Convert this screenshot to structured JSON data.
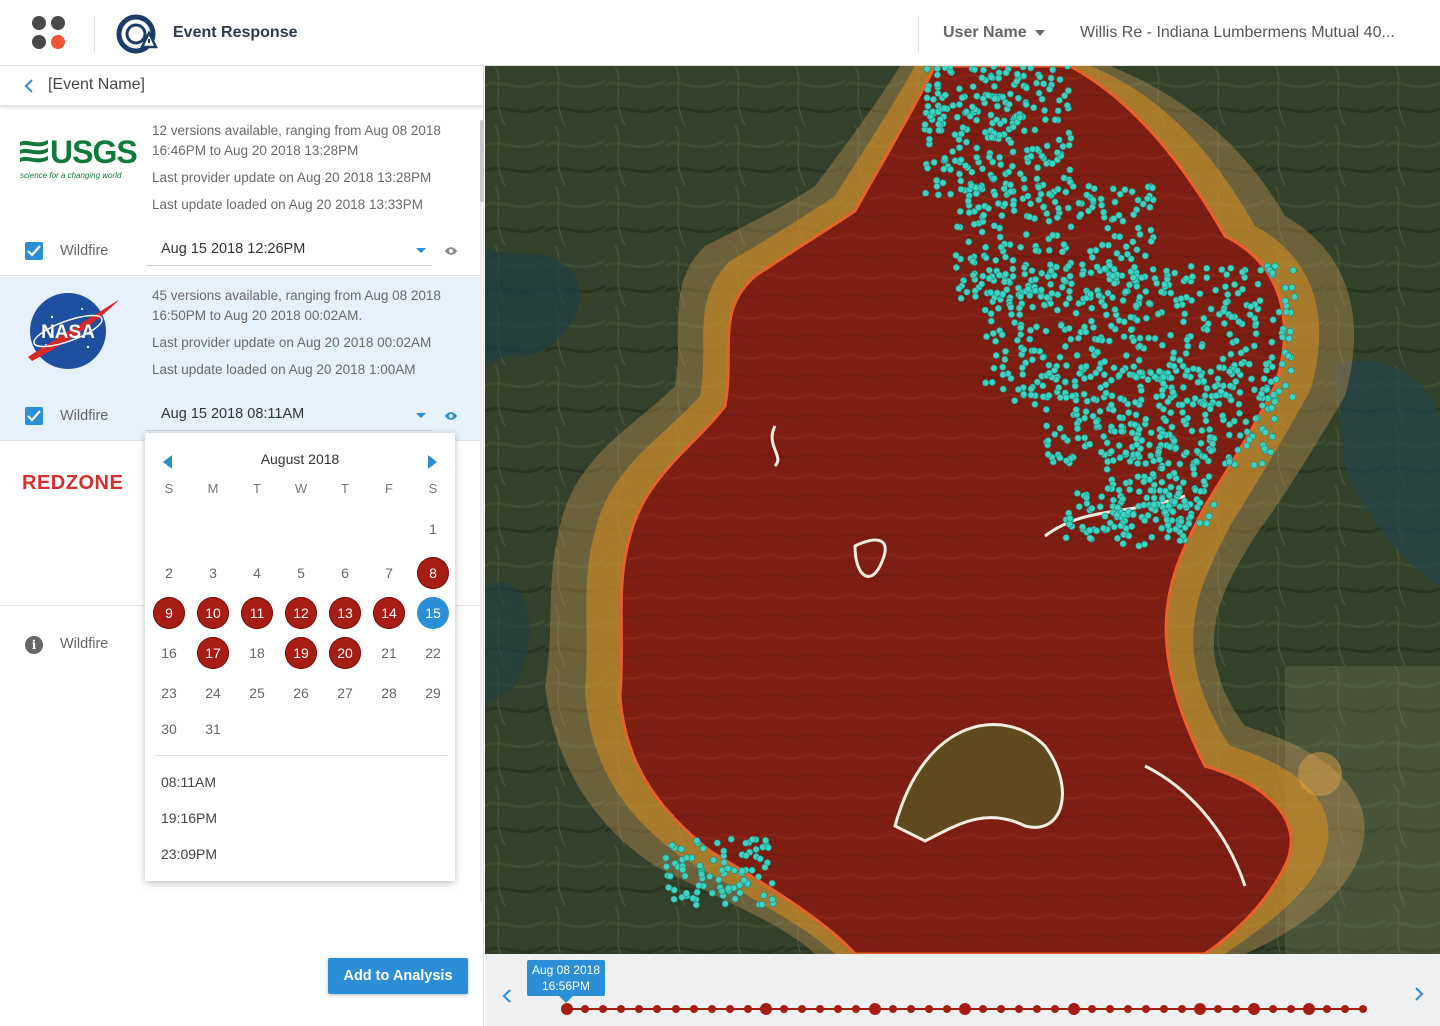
{
  "header": {
    "app_title": "Event Response",
    "user_menu_label": "User Name",
    "account_name": "Willis Re - Indiana Lumbermens Mutual 40..."
  },
  "event": {
    "name": "[Event Name]"
  },
  "providers": [
    {
      "logo_word": "USGS",
      "logo_tagline": "science for a changing world",
      "versions_text": "12 versions available, ranging from Aug 08 2018 16:46PM to Aug 20 2018 13:28PM",
      "provider_update": "Last provider update on Aug 20 2018 13:28PM",
      "loaded_update": "Last update loaded on Aug 20 2018 13:33PM",
      "hazard": "Wildfire",
      "selected_version": "Aug 15 2018 12:26PM",
      "checked": true
    },
    {
      "logo_word": "NASA",
      "versions_text": "45 versions available, ranging from Aug 08 2018 16:50PM to Aug 20 2018 00:02AM.",
      "provider_update": "Last provider update on Aug 20 2018 00:02AM",
      "loaded_update": "Last update loaded on Aug 20 2018 1:00AM",
      "hazard": "Wildfire",
      "selected_version": "Aug 15 2018 08:11AM",
      "checked": true
    },
    {
      "logo_word": "REDZONE",
      "hazard": "Wildfire",
      "checked": false
    }
  ],
  "calendar": {
    "month_label": "August 2018",
    "weekdays": [
      "S",
      "M",
      "T",
      "W",
      "T",
      "F",
      "S"
    ],
    "first_weekday_index": 6,
    "days_in_month": 31,
    "available_days": [
      8,
      9,
      10,
      11,
      12,
      13,
      14,
      17,
      19,
      20
    ],
    "selected_day": 15,
    "times": [
      "08:11AM",
      "19:16PM",
      "23:09PM"
    ]
  },
  "actions": {
    "add_to_analysis": "Add to Analysis"
  },
  "timeline": {
    "tooltip_date": "Aug 08 2018",
    "tooltip_time": "16:56PM",
    "dot_count": 45,
    "highlighted_dots": [
      0,
      11,
      17,
      22,
      28,
      35,
      38,
      41
    ]
  },
  "colors": {
    "accent": "#2a8fd6",
    "fire_red": "#a81d13",
    "exposure_teal": "#3fd2c1",
    "buffer_orange": "#e39a1e"
  },
  "icons": {
    "apps": "apps-grid-icon",
    "app_logo": "event-response-logo-icon",
    "back": "chevron-left-icon",
    "eye": "eye-icon",
    "info": "info-icon"
  }
}
